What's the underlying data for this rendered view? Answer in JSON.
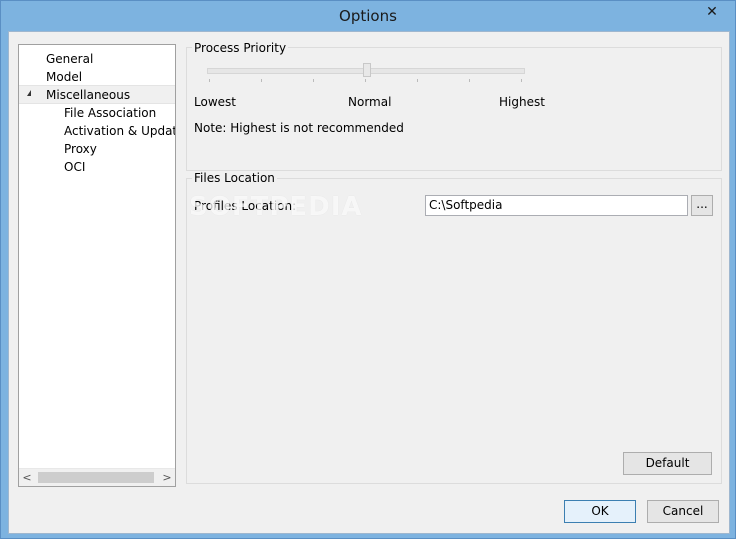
{
  "window": {
    "title": "Options",
    "close_glyph": "✕"
  },
  "tree": {
    "items": [
      {
        "label": "General"
      },
      {
        "label": "Model"
      },
      {
        "label": "Miscellaneous"
      },
      {
        "label": "File Association"
      },
      {
        "label": "Activation & Updater"
      },
      {
        "label": "Proxy"
      },
      {
        "label": "OCI"
      }
    ],
    "scroll_left": "<",
    "scroll_right": ">"
  },
  "process_priority": {
    "title": "Process Priority",
    "labels": {
      "low": "Lowest",
      "mid": "Normal",
      "high": "Highest"
    },
    "note": "Note: Highest is not recommended",
    "level": "Normal"
  },
  "files_location": {
    "title": "Files Location",
    "profiles_label": "Profiles Location:",
    "profiles_value": "C:\\Softpedia",
    "browse_label": "..."
  },
  "watermark": "SOFTPEDIA",
  "buttons": {
    "default": "Default",
    "ok": "OK",
    "cancel": "Cancel"
  },
  "colors": {
    "frame": "#7db3e0",
    "client": "#f0f0f0",
    "focus_border": "#3c7fb1"
  }
}
